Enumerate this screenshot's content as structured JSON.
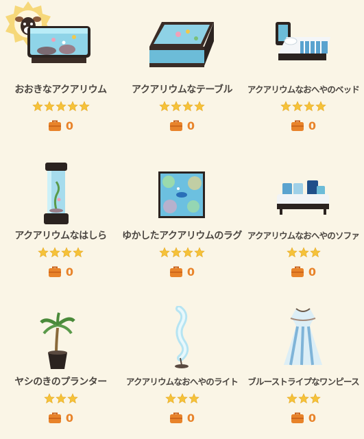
{
  "items": [
    {
      "name": "おおきなアクアリウム",
      "stars": 5,
      "count": "0",
      "icon": "large-aquarium-icon"
    },
    {
      "name": "アクアリウムなテーブル",
      "stars": 4,
      "count": "0",
      "icon": "aquarium-table-icon"
    },
    {
      "name": "アクアリウムなおへやのベッド",
      "stars": 4,
      "count": "0",
      "icon": "aquarium-bed-icon"
    },
    {
      "name": "アクアリウムなはしら",
      "stars": 4,
      "count": "0",
      "icon": "aquarium-pillar-icon"
    },
    {
      "name": "ゆかしたアクアリウムのラグ",
      "stars": 4,
      "count": "0",
      "icon": "aquarium-rug-icon"
    },
    {
      "name": "アクアリウムなおへやのソファ",
      "stars": 3,
      "count": "0",
      "icon": "aquarium-sofa-icon"
    },
    {
      "name": "ヤシのきのプランター",
      "stars": 3,
      "count": "0",
      "icon": "palm-planter-icon"
    },
    {
      "name": "アクアリウムなおへやのライト",
      "stars": 3,
      "count": "0",
      "icon": "aquarium-lamp-icon"
    },
    {
      "name": "ブルーストライプなワンピース",
      "stars": 3,
      "count": "0",
      "icon": "blue-stripe-dress-icon"
    }
  ],
  "badge_icon": "deer-avatar-badge-icon",
  "counter_icon": "orange-toolbox-icon",
  "colors": {
    "star": "#f5c23a",
    "count": "#e8832a",
    "text": "#4a4540",
    "background": "#faf5e6"
  }
}
